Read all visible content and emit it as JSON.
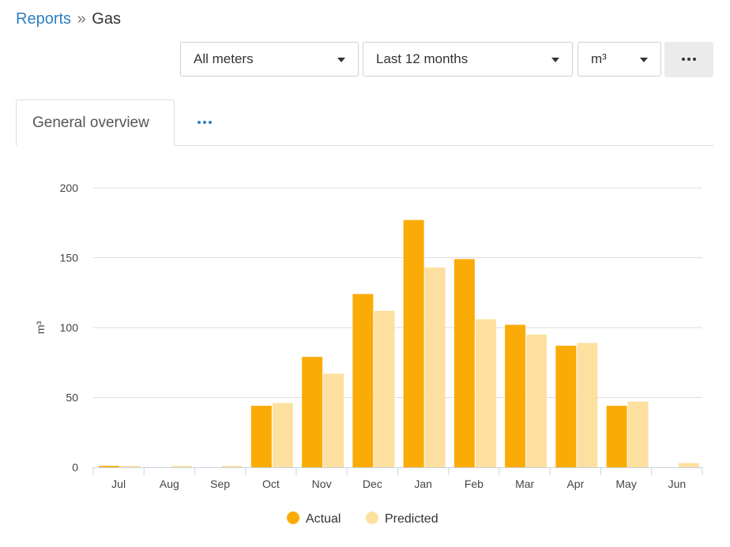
{
  "breadcrumb": {
    "parent": "Reports",
    "separator": "»",
    "current": "Gas"
  },
  "filters": {
    "meter": "All meters",
    "period": "Last 12 months",
    "unit": "m³",
    "more_icon": "ellipsis-icon"
  },
  "tabs": [
    {
      "label": "General overview",
      "active": true
    }
  ],
  "tabs_more_icon": "ellipsis-icon",
  "colors": {
    "actual": "#FBAB06",
    "predicted": "#FDE0A0",
    "link": "#2f7fbf",
    "grid": "#dddddd"
  },
  "chart_data": {
    "type": "bar",
    "ylabel": "m³",
    "ylim": [
      0,
      200
    ],
    "yticks": [
      0,
      50,
      100,
      150,
      200
    ],
    "grid": true,
    "legend_position": "bottom",
    "categories": [
      "Jul",
      "Aug",
      "Sep",
      "Oct",
      "Nov",
      "Dec",
      "Jan",
      "Feb",
      "Mar",
      "Apr",
      "May",
      "Jun"
    ],
    "series": [
      {
        "name": "Actual",
        "color": "#FBAB06",
        "values": [
          1,
          0,
          0,
          44,
          79,
          124,
          177,
          149,
          102,
          87,
          44,
          0
        ]
      },
      {
        "name": "Predicted",
        "color": "#FDE0A0",
        "values": [
          1,
          1,
          1,
          46,
          67,
          112,
          143,
          106,
          95,
          89,
          47,
          3
        ]
      }
    ]
  }
}
